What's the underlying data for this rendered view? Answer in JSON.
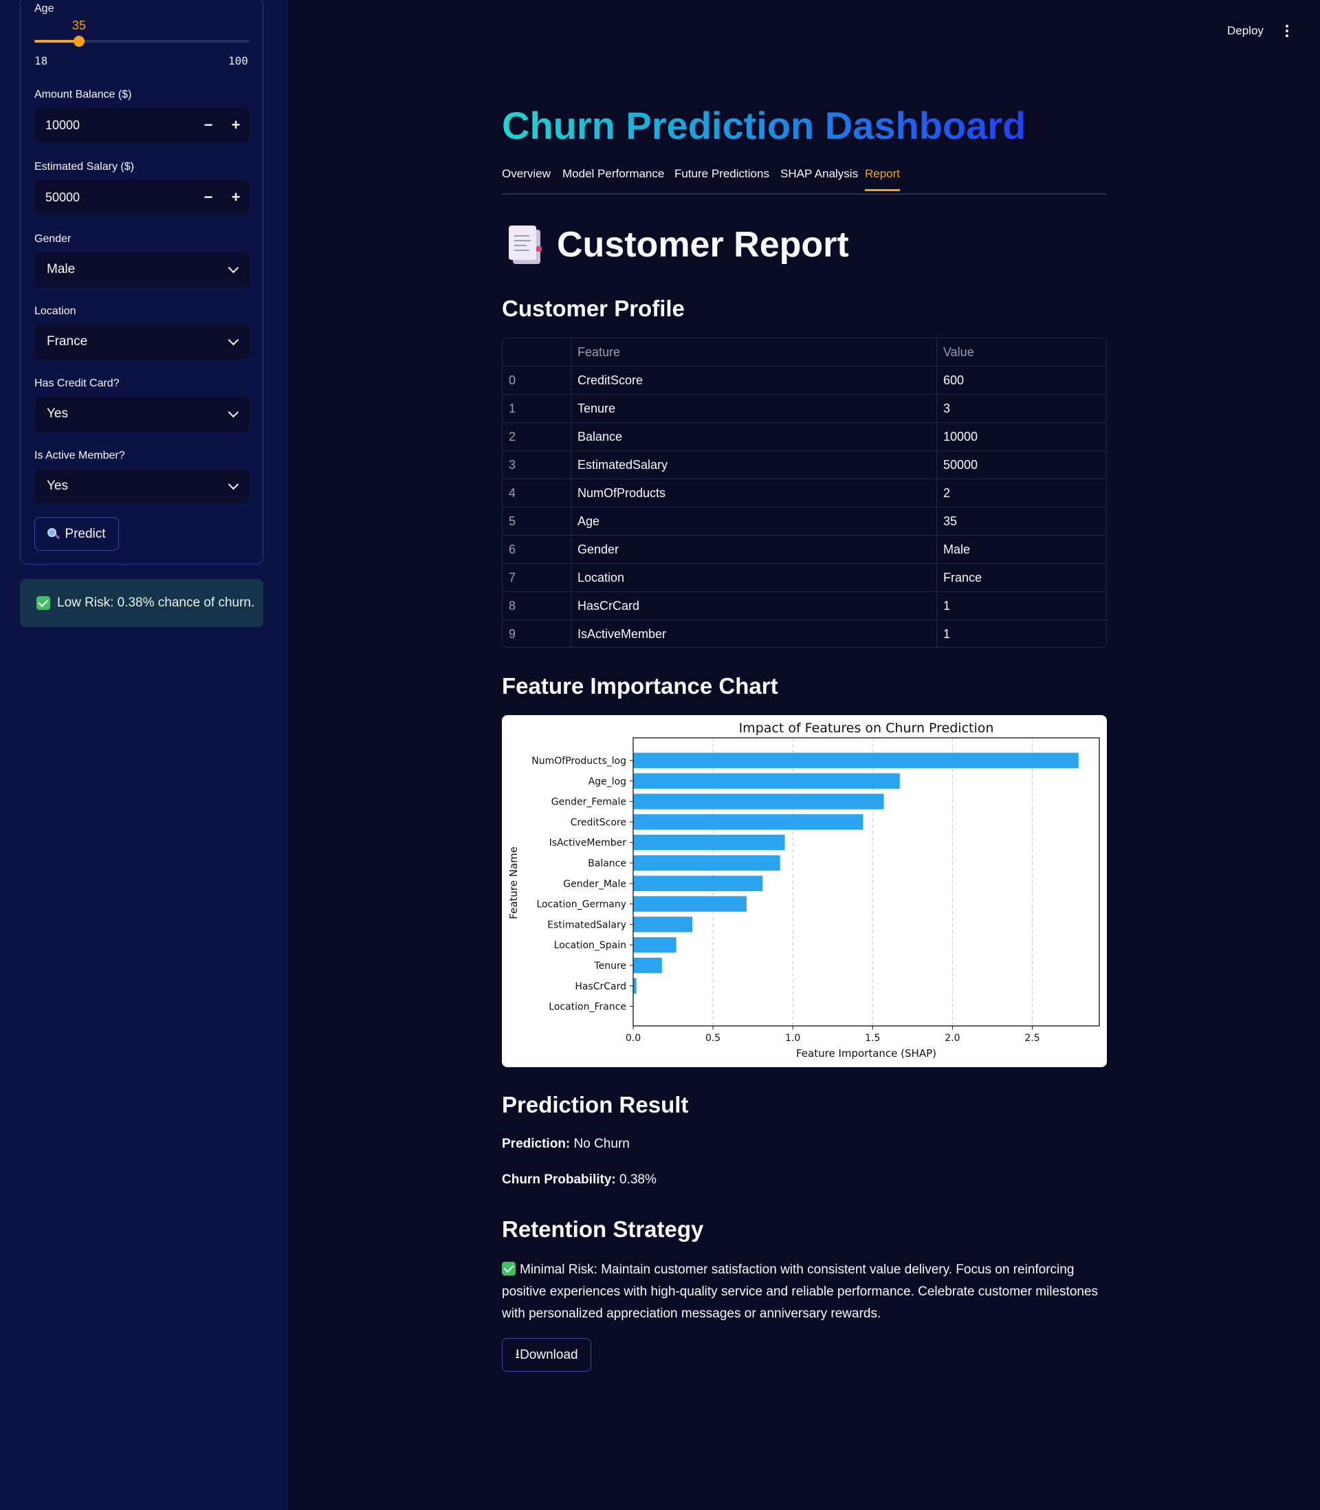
{
  "sidebar": {
    "age": {
      "label": "Age",
      "value": "35",
      "min_label": "18",
      "max_label": "100",
      "min": 18,
      "max": 100,
      "current": 35
    },
    "balance": {
      "label": "Amount Balance ($)",
      "value": "10000",
      "minus": "−",
      "plus": "+"
    },
    "salary": {
      "label": "Estimated Salary ($)",
      "value": "50000",
      "minus": "−",
      "plus": "+"
    },
    "gender": {
      "label": "Gender",
      "value": "Male"
    },
    "location": {
      "label": "Location",
      "value": "France"
    },
    "credit_card": {
      "label": "Has Credit Card?",
      "value": "Yes"
    },
    "active": {
      "label": "Is Active Member?",
      "value": "Yes"
    },
    "predict_label": "Predict",
    "alert": "Low Risk: 0.38% chance of churn."
  },
  "header": {
    "deploy": "Deploy"
  },
  "main": {
    "title": "Churn Prediction Dashboard",
    "tabs": [
      {
        "label": "Overview"
      },
      {
        "label": "Model Performance"
      },
      {
        "label": "Future Predictions"
      },
      {
        "label": "SHAP Analysis"
      },
      {
        "label": "Report"
      }
    ],
    "active_tab": "Report",
    "report_title": "Customer Report",
    "profile_heading": "Customer Profile",
    "table": {
      "headers": [
        "",
        "Feature",
        "Value"
      ],
      "rows": [
        [
          "0",
          "CreditScore",
          "600"
        ],
        [
          "1",
          "Tenure",
          "3"
        ],
        [
          "2",
          "Balance",
          "10000"
        ],
        [
          "3",
          "EstimatedSalary",
          "50000"
        ],
        [
          "4",
          "NumOfProducts",
          "2"
        ],
        [
          "5",
          "Age",
          "35"
        ],
        [
          "6",
          "Gender",
          "Male"
        ],
        [
          "7",
          "Location",
          "France"
        ],
        [
          "8",
          "HasCrCard",
          "1"
        ],
        [
          "9",
          "IsActiveMember",
          "1"
        ]
      ]
    },
    "chart_heading": "Feature Importance Chart",
    "prediction_heading": "Prediction Result",
    "prediction_key": "Prediction:",
    "prediction_value": "No Churn",
    "probability_key": "Churn Probability:",
    "probability_value": "0.38%",
    "strategy_heading": "Retention Strategy",
    "strategy_text": "Minimal Risk: Maintain customer satisfaction with consistent value delivery. Focus on reinforcing positive experiences with high-quality service and reliable performance. Celebrate customer milestones with personalized appreciation messages or anniversary rewards.",
    "download_label": "Download",
    "download_glyph": "⭳"
  },
  "colors": {
    "accent": "#f5a31a",
    "bar": "#2ca3ee",
    "success": "#40c060"
  },
  "chart_data": {
    "type": "bar",
    "orientation": "horizontal",
    "title": "Impact of Features on Churn Prediction",
    "xlabel": "Feature Importance (SHAP)",
    "ylabel": "Feature Name",
    "categories": [
      "NumOfProducts_log",
      "Age_log",
      "Gender_Female",
      "CreditScore",
      "IsActiveMember",
      "Balance",
      "Gender_Male",
      "Location_Germany",
      "EstimatedSalary",
      "Location_Spain",
      "Tenure",
      "HasCrCard",
      "Location_France"
    ],
    "values": [
      2.79,
      1.67,
      1.57,
      1.44,
      0.95,
      0.92,
      0.81,
      0.71,
      0.37,
      0.27,
      0.18,
      0.02,
      0.0
    ],
    "xlim": [
      0,
      2.92
    ],
    "xticks": [
      0.0,
      0.5,
      1.0,
      1.5,
      2.0,
      2.5
    ],
    "xtick_labels": [
      "0.0",
      "0.5",
      "1.0",
      "1.5",
      "2.0",
      "2.5"
    ],
    "grid": "x dashed"
  }
}
